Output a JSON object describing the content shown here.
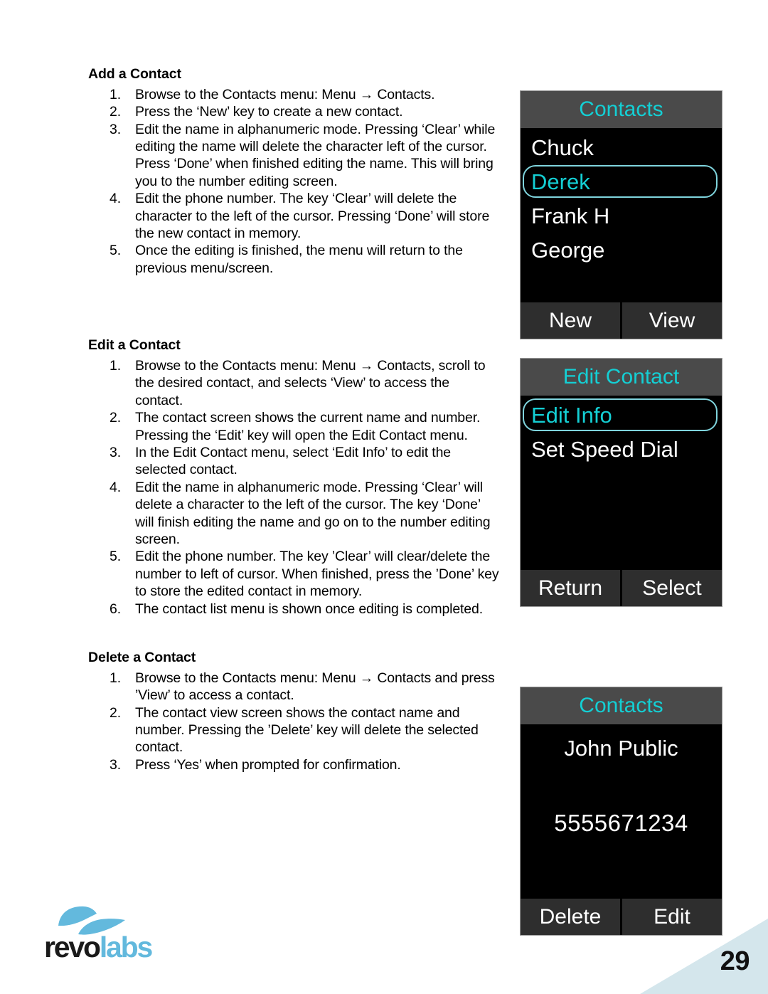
{
  "document": {
    "page_number": "29",
    "sections": [
      {
        "heading": "Add a Contact",
        "steps": [
          {
            "num": "1.",
            "text": "Browse to the Contacts menu: Menu → Contacts."
          },
          {
            "num": "2.",
            "text": "Press the ‘New’ key to create a new contact."
          },
          {
            "num": "3.",
            "text": "Edit the name in alphanumeric mode.  Pressing ‘Clear’ while editing the name will delete the character left of the cursor.  Press ‘Done’ when finished editing the name.  This will bring you to the number editing screen."
          },
          {
            "num": "4.",
            "text": "Edit the phone number.  The key ‘Clear’ will delete the character to the left of the cursor.  Pressing ‘Done’ will store the new contact in memory."
          },
          {
            "num": "5.",
            "text": "Once the editing is finished, the menu will return to the previous menu/screen."
          }
        ]
      },
      {
        "heading": "Edit a Contact",
        "steps": [
          {
            "num": "1.",
            "text": "Browse to the Contacts menu: Menu → Contacts, scroll to the desired contact, and selects ‘View’ to access the contact."
          },
          {
            "num": "2.",
            "text": "The contact screen shows the current name and number.  Pressing the ‘Edit’ key will open the Edit Contact menu."
          },
          {
            "num": "3.",
            "text": "In the Edit Contact menu, select ‘Edit Info’ to edit the selected contact."
          },
          {
            "num": "4.",
            "text": "Edit the name in alphanumeric mode.  Pressing ‘Clear’ will delete a character to the left of the cursor.  The key ‘Done’ will finish editing the name and go on to the number editing screen."
          },
          {
            "num": "5.",
            "text": "Edit the phone number.  The key ’Clear’ will clear/delete the number to left of cursor.  When finished, press the ’Done’ key to store the edited contact in memory."
          },
          {
            "num": "6.",
            "text": "The contact list menu is shown once editing is completed."
          }
        ]
      },
      {
        "heading": "Delete a Contact",
        "steps": [
          {
            "num": "1.",
            "text": "Browse to the Contacts menu: Menu → Contacts and press ’View’ to access a contact."
          },
          {
            "num": "2.",
            "text": "The contact view screen shows the contact name and number.  Pressing the ’Delete’ key will delete the selected contact."
          },
          {
            "num": "3.",
            "text": "Press ‘Yes’ when prompted for confirmation."
          }
        ]
      }
    ]
  },
  "screens": {
    "contacts_list": {
      "title": "Contacts",
      "items": [
        {
          "label": "Chuck",
          "selected": false
        },
        {
          "label": "Derek",
          "selected": true
        },
        {
          "label": "Frank H",
          "selected": false
        },
        {
          "label": "George",
          "selected": false
        }
      ],
      "softkey_left": "New",
      "softkey_right": "View"
    },
    "edit_contact": {
      "title": "Edit Contact",
      "items": [
        {
          "label": "Edit Info",
          "selected": true
        },
        {
          "label": "Set Speed Dial",
          "selected": false
        }
      ],
      "softkey_left": "Return",
      "softkey_right": "Select"
    },
    "contact_view": {
      "title": "Contacts",
      "contact_name": "John Public",
      "contact_number": "5555671234",
      "softkey_left": "Delete",
      "softkey_right": "Edit"
    }
  },
  "branding": {
    "logo_text_dark": "revo",
    "logo_text_light": "labs",
    "accent_cyan": "#14cfd4",
    "accent_blue": "#63b9dd",
    "corner_blue": "#d4e6ec",
    "header_gray": "#4a4a4a",
    "softkey_gray": "#2e2e2e"
  }
}
